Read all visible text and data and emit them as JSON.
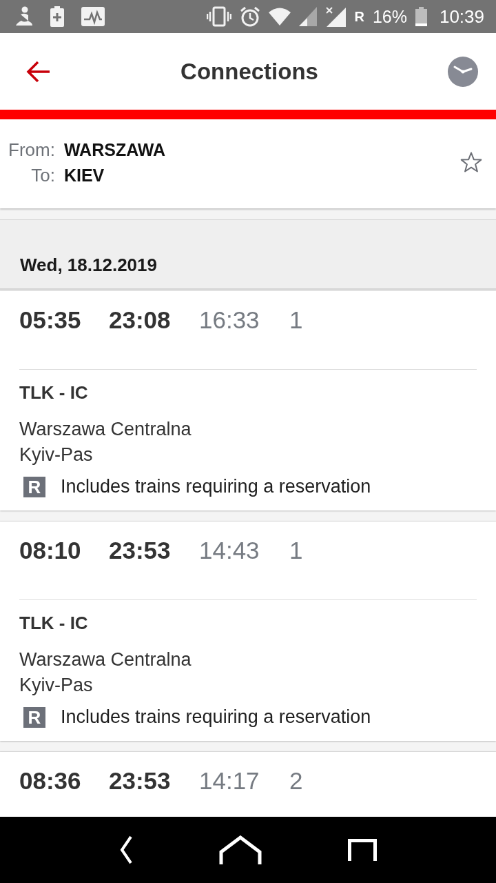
{
  "status_bar": {
    "roaming": "R",
    "battery": "16%",
    "time": "10:39"
  },
  "app_bar": {
    "title": "Connections"
  },
  "route": {
    "from_label": "From:",
    "from": "WARSZAWA",
    "to_label": "To:",
    "to": "KIEV",
    "favorite": false
  },
  "date_header": "Wed, 18.12.2019",
  "connections": [
    {
      "departure": "05:35",
      "arrival": "23:08",
      "duration": "16:33",
      "changes": "1",
      "trains": "TLK - IC",
      "origin": "Warszawa Centralna",
      "destination": "Kyiv-Pas",
      "notice": {
        "badge": "R",
        "text": "Includes trains requiring a reservation"
      }
    },
    {
      "departure": "08:10",
      "arrival": "23:53",
      "duration": "14:43",
      "changes": "1",
      "trains": "TLK - IC",
      "origin": "Warszawa Centralna",
      "destination": "Kyiv-Pas",
      "notice": {
        "badge": "R",
        "text": "Includes trains requiring a reservation"
      }
    },
    {
      "departure": "08:36",
      "arrival": "23:53",
      "duration": "14:17",
      "changes": "2"
    }
  ]
}
